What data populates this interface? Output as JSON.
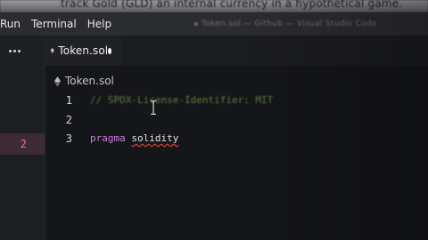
{
  "top_strip": {
    "text": "track Gold (GLD) an internal currency in a hypothetical game."
  },
  "menubar": {
    "items": [
      "Run",
      "Terminal",
      "Help"
    ],
    "window_title": "Token.sol — Github — Visual Studio Code"
  },
  "activity": {
    "more_icon": "ellipsis-icon",
    "changes_count": "2"
  },
  "tabs": [
    {
      "label": "Token.sol",
      "icon": "solidity-icon",
      "unsaved": true
    }
  ],
  "breadcrumb": {
    "file": "Token.sol",
    "icon": "solidity-icon"
  },
  "editor": {
    "lines": [
      {
        "number": "1",
        "tokens": [
          {
            "text": "// SPDX-License-Identifier: MIT",
            "kind": "comment"
          }
        ]
      },
      {
        "number": "2",
        "tokens": []
      },
      {
        "number": "3",
        "tokens": [
          {
            "text": "pragma",
            "kind": "keyword"
          },
          {
            "text": " ",
            "kind": "space"
          },
          {
            "text": "solidity",
            "kind": "error"
          }
        ]
      }
    ]
  },
  "colors": {
    "background": "#151619",
    "comment": "#5d7e3c",
    "keyword": "#c681d3",
    "error_underline": "#e0443a",
    "badge": "#e27b8e"
  }
}
